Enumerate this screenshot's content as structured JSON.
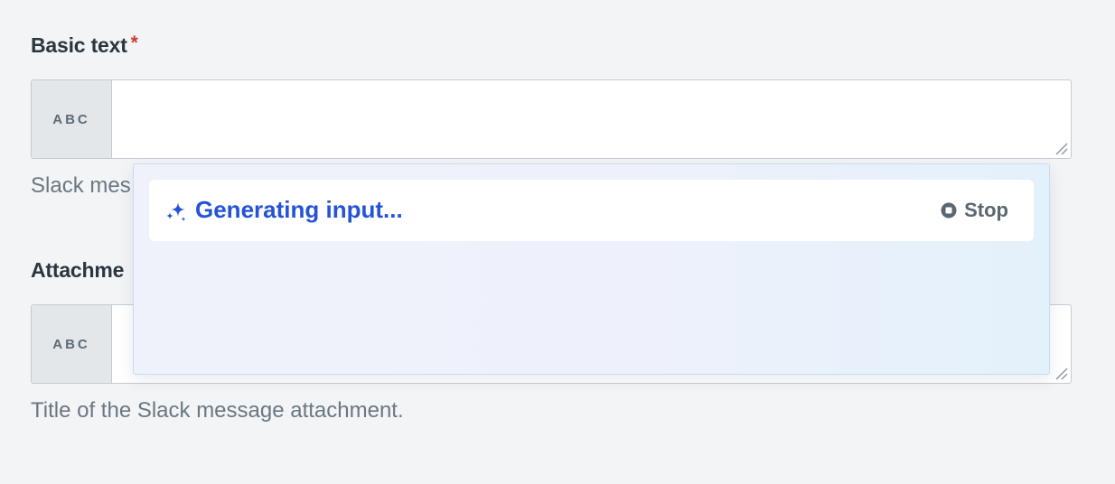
{
  "fields": [
    {
      "label": "Basic text",
      "required_mark": "*",
      "type_badge": "ABC",
      "help_text": "Slack mes"
    },
    {
      "label": "Attachme",
      "type_badge": "ABC",
      "help_text": "Title of the Slack message attachment."
    }
  ],
  "ai_popover": {
    "status_text": "Generating input...",
    "stop_label": "Stop",
    "accent_color": "#2553d8"
  },
  "icons": {
    "sparkle": "sparkle-icon",
    "stop": "stop-icon",
    "resize": "resize-handle-icon"
  }
}
